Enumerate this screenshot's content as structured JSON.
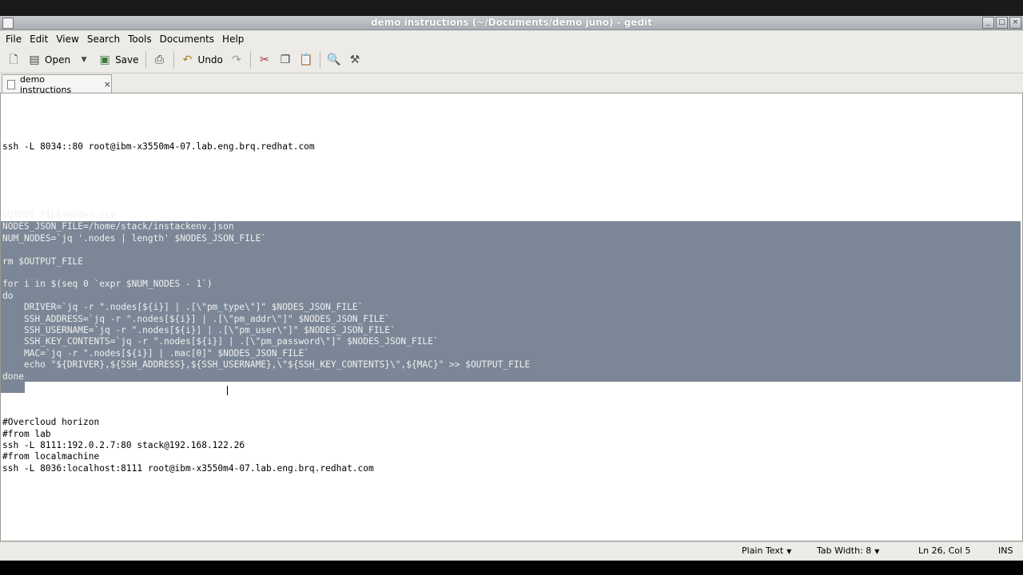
{
  "window": {
    "title": "demo instructions (~/Documents/demo juno) - gedit"
  },
  "menubar": {
    "items": [
      "File",
      "Edit",
      "View",
      "Search",
      "Tools",
      "Documents",
      "Help"
    ]
  },
  "toolbar": {
    "new_icon": "new-document-icon",
    "open_label": "Open",
    "save_label": "Save",
    "undo_label": "Undo"
  },
  "tab": {
    "label": "demo instructions",
    "close": "×"
  },
  "editor": {
    "lines": [
      "",
      "",
      "",
      "",
      "ssh -L 8034::80 root@ibm-x3550m4-07.lab.eng.brq.redhat.com",
      "",
      "",
      "",
      "",
      "",
      "OUTPUT_FILE=nodes.csv",
      "NODES_JSON_FILE=/home/stack/instackenv.json",
      "NUM_NODES=`jq '.nodes | length' $NODES_JSON_FILE`",
      "",
      "rm $OUTPUT_FILE",
      "",
      "for i in $(seq 0 `expr $NUM_NODES - 1`)",
      "do",
      "    DRIVER=`jq -r \".nodes[${i}] | .[\\\"pm_type\\\"]\" $NODES_JSON_FILE`",
      "    SSH_ADDRESS=`jq -r \".nodes[${i}] | .[\\\"pm_addr\\\"]\" $NODES_JSON_FILE`",
      "    SSH_USERNAME=`jq -r \".nodes[${i}] | .[\\\"pm_user\\\"]\" $NODES_JSON_FILE`",
      "    SSH_KEY_CONTENTS=`jq -r \".nodes[${i}] | .[\\\"pm_password\\\"]\" $NODES_JSON_FILE`",
      "    MAC=`jq -r \".nodes[${i}] | .mac[0]\" $NODES_JSON_FILE`",
      "    echo \"${DRIVER},${SSH_ADDRESS},${SSH_USERNAME},\\\"${SSH_KEY_CONTENTS}\\\",${MAC}\" >> $OUTPUT_FILE",
      "done",
      "",
      "",
      "",
      "#Overcloud horizon",
      "#from lab",
      "ssh -L 8111:192.0.2.7:80 stack@192.168.122.26",
      "#from localmachine",
      "ssh -L 8036:localhost:8111 root@ibm-x3550m4-07.lab.eng.brq.redhat.com"
    ],
    "selection_color": "#7b8796"
  },
  "statusbar": {
    "language": "Plain Text",
    "tab_width": "Tab Width:  8",
    "position": "Ln 26, Col 5",
    "mode": "INS"
  }
}
